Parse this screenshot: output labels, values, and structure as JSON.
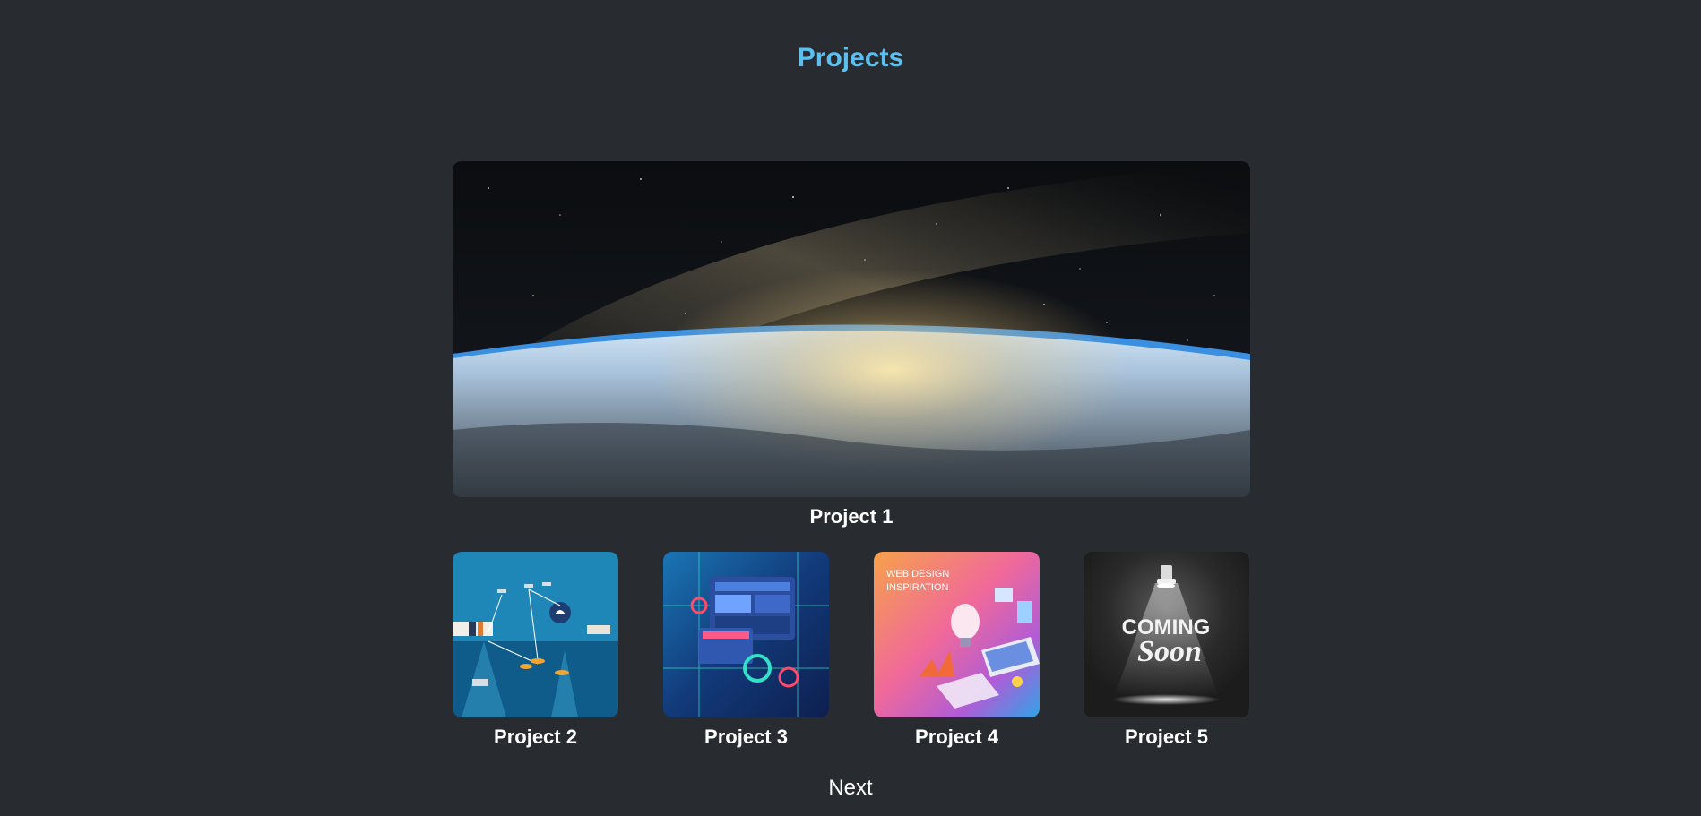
{
  "page": {
    "title": "Projects",
    "background": "#282c30",
    "accent": "#5bc0f0"
  },
  "featured": {
    "caption": "Project 1",
    "image": "earth-from-space-image"
  },
  "projects": [
    {
      "caption": "Project 2",
      "image": "ocean-satellite-illustration-image"
    },
    {
      "caption": "Project 3",
      "image": "tech-dashboard-illustration-image"
    },
    {
      "caption": "Project 4",
      "image": "web-design-inspiration-image",
      "image_text": [
        "WEB DESIGN",
        "INSPIRATION"
      ]
    },
    {
      "caption": "Project 5",
      "image": "coming-soon-spotlight-image",
      "image_text": [
        "COMING",
        "Soon"
      ]
    }
  ],
  "pagination": {
    "next_label": "Next"
  }
}
